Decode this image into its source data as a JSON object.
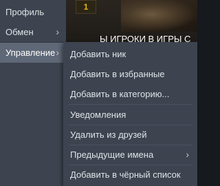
{
  "background": {
    "badge": "1",
    "partial_text": "Ы ИГРОКИ В ИГРЫ С"
  },
  "side_menu": {
    "items": [
      {
        "label": "Профиль",
        "has_arrow": false
      },
      {
        "label": "Обмен",
        "has_arrow": true,
        "arrow": "›"
      },
      {
        "label": "Управление",
        "has_arrow": true,
        "arrow": "›",
        "active": true
      }
    ]
  },
  "submenu": {
    "items": [
      {
        "label": "Добавить ник"
      },
      {
        "label": "Добавить в избранные"
      },
      {
        "label": "Добавить в категорию..."
      },
      {
        "label": "Уведомления"
      },
      {
        "label": "Удалить из друзей"
      },
      {
        "label": "Предыдущие имена",
        "arrow": "›"
      },
      {
        "label": "Добавить в чёрный список"
      }
    ]
  },
  "colors": {
    "menu_bg": "#3d4450",
    "menu_active": "#5f6877",
    "text": "#dfe3e6",
    "badge_text": "#e8b500"
  }
}
